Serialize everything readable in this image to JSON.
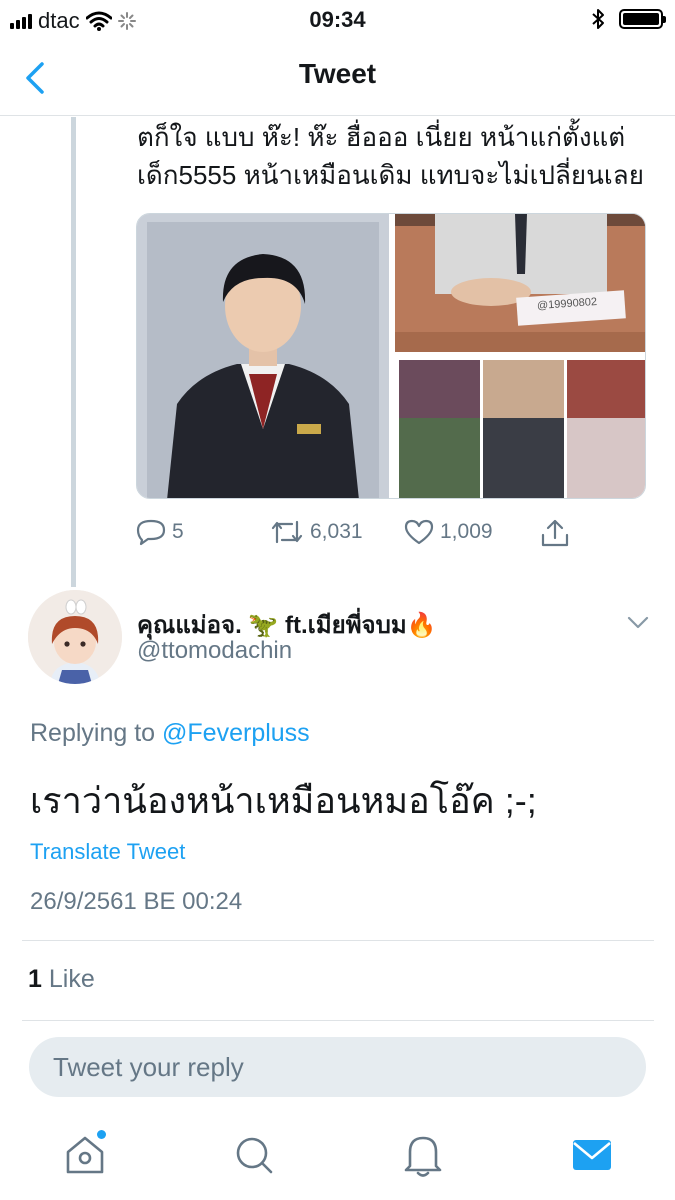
{
  "status_bar": {
    "carrier": "dtac",
    "time": "09:34",
    "icons": [
      "signal-icon",
      "wifi-icon",
      "activity-icon",
      "bluetooth-icon",
      "battery-icon"
    ]
  },
  "nav": {
    "title": "Tweet",
    "back_icon": "chevron-left-icon"
  },
  "previous_tweet": {
    "text_line1": "ตก็ใจ แบบ ห๊ะ! ห๊ะ ฮื่อออ เนี่ยย หน้าแก่ตั้งแต่",
    "text_line2": "เด็ก5555 หน้าเหมือนเดิม แทบจะไม่เปลี่ยนเลย",
    "photo_caption": "@19990802",
    "actions": {
      "replies": "5",
      "retweets": "6,031",
      "likes": "1,009"
    }
  },
  "tweet": {
    "display_name": "คุณแม่อจ. 🦖 ft.เมียพี่จบม🔥",
    "handle": "@ttomodachin",
    "replying_prefix": "Replying to",
    "replying_to": "@Feverpluss",
    "text": "เราว่าน้องหน้าเหมือนหมอโอ๊ค ;-;",
    "translate_label": "Translate Tweet",
    "timestamp": "26/9/2561 BE 00:24",
    "like_count": "1",
    "like_label": "Like"
  },
  "reply_box": {
    "placeholder": "Tweet your reply"
  },
  "colors": {
    "accent": "#1da1f2",
    "secondary_text": "#657786",
    "divider": "#dfe3e6"
  },
  "tabs": [
    "home-icon",
    "search-icon",
    "notifications-icon",
    "messages-icon"
  ]
}
